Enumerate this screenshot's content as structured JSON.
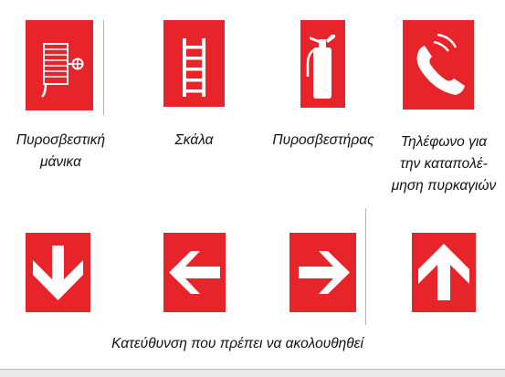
{
  "signs": [
    {
      "id": "fire-hose",
      "caption_lines": [
        "Πυροσβεστική",
        "μάνικα"
      ],
      "icon": "fire-hose-reel-icon"
    },
    {
      "id": "ladder",
      "caption_lines": [
        "Σκάλα"
      ],
      "icon": "ladder-icon"
    },
    {
      "id": "extinguisher",
      "caption_lines": [
        "Πυροσβεστήρας"
      ],
      "icon": "fire-extinguisher-icon"
    },
    {
      "id": "phone",
      "caption_lines": [
        "Τηλέφωνο για",
        "την καταπολέ-",
        "μηση πυρκαγιών"
      ],
      "icon": "telephone-icon"
    }
  ],
  "direction_signs": {
    "caption": "Κατεύθυνση που πρέπει να ακολουθηθεί",
    "icons": [
      "arrow-down-icon",
      "arrow-left-icon",
      "arrow-right-icon",
      "arrow-up-icon"
    ]
  },
  "colors": {
    "sign_red": "#e8242b",
    "symbol_white": "#ffffff"
  }
}
